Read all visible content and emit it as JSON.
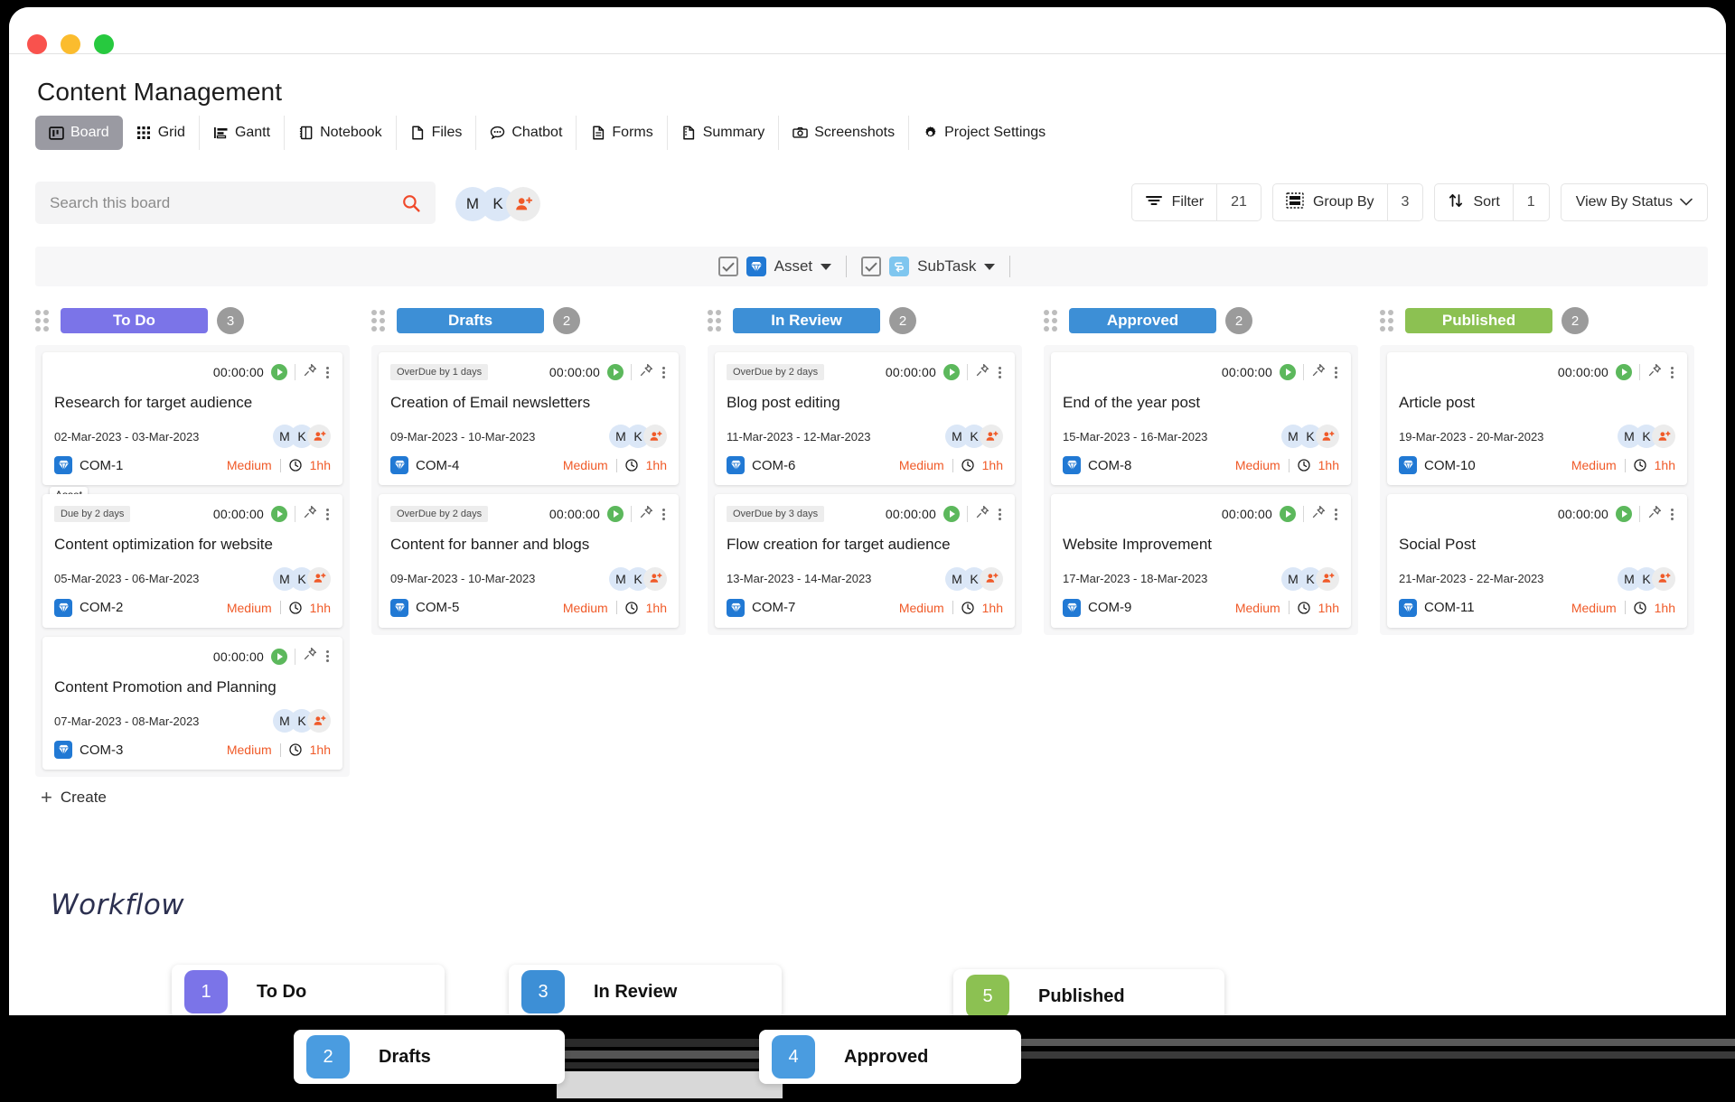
{
  "window": {
    "traffic_lights": [
      "close",
      "minimize",
      "maximize"
    ]
  },
  "header": {
    "title": "Content Management"
  },
  "tabs": [
    {
      "label": "Board",
      "icon": "board-icon",
      "active": true
    },
    {
      "label": "Grid",
      "icon": "grid-icon",
      "active": false
    },
    {
      "label": "Gantt",
      "icon": "gantt-icon",
      "active": false
    },
    {
      "label": "Notebook",
      "icon": "notebook-icon",
      "active": false
    },
    {
      "label": "Files",
      "icon": "file-icon",
      "active": false
    },
    {
      "label": "Chatbot",
      "icon": "chat-icon",
      "active": false
    },
    {
      "label": "Forms",
      "icon": "form-icon",
      "active": false
    },
    {
      "label": "Summary",
      "icon": "summary-icon",
      "active": false
    },
    {
      "label": "Screenshots",
      "icon": "camera-icon",
      "active": false
    },
    {
      "label": "Project Settings",
      "icon": "gear-icon",
      "active": false
    }
  ],
  "toolbar": {
    "search": {
      "placeholder": "Search this board",
      "value": ""
    },
    "avatars": [
      {
        "initial": "M",
        "color": "#dbe7f7"
      },
      {
        "initial": "K",
        "color": "#dbe7f7"
      }
    ],
    "add_user_label": "add-user",
    "filter": {
      "label": "Filter",
      "count": "21"
    },
    "group_by": {
      "label": "Group By",
      "count": "3"
    },
    "sort": {
      "label": "Sort",
      "count": "1"
    },
    "view": {
      "label": "View By Status"
    }
  },
  "subbar": {
    "asset": {
      "label": "Asset",
      "checked": true
    },
    "subtask": {
      "label": "SubTask",
      "checked": true
    }
  },
  "columns": [
    {
      "name": "To Do",
      "color": "#7b74e8",
      "count": "3",
      "create_label": "Create",
      "show_create": true,
      "cards": [
        {
          "due_badge": "",
          "timer": "00:00:00",
          "title": "Research for target audience",
          "dates": "02-Mar-2023 - 03-Mar-2023",
          "ticket": "COM-1",
          "priority": "Medium",
          "estimate": "1hh",
          "avatars": [
            "M",
            "K"
          ],
          "tooltip": "Asset"
        },
        {
          "due_badge": "Due by 2 days",
          "timer": "00:00:00",
          "title": "Content optimization for website",
          "dates": "05-Mar-2023 - 06-Mar-2023",
          "ticket": "COM-2",
          "priority": "Medium",
          "estimate": "1hh",
          "avatars": [
            "M",
            "K"
          ],
          "tooltip": ""
        },
        {
          "due_badge": "",
          "timer": "00:00:00",
          "title": "Content Promotion and Planning",
          "dates": "07-Mar-2023 - 08-Mar-2023",
          "ticket": "COM-3",
          "priority": "Medium",
          "estimate": "1hh",
          "avatars": [
            "M",
            "K"
          ],
          "tooltip": ""
        }
      ]
    },
    {
      "name": "Drafts",
      "color": "#3d8fd6",
      "count": "2",
      "create_label": "Create",
      "show_create": false,
      "cards": [
        {
          "due_badge": "OverDue by 1 days",
          "timer": "00:00:00",
          "title": "Creation of Email newsletters",
          "dates": "09-Mar-2023 - 10-Mar-2023",
          "ticket": "COM-4",
          "priority": "Medium",
          "estimate": "1hh",
          "avatars": [
            "M",
            "K"
          ],
          "tooltip": ""
        },
        {
          "due_badge": "OverDue by 2 days",
          "timer": "00:00:00",
          "title": "Content for banner and blogs",
          "dates": "09-Mar-2023 - 10-Mar-2023",
          "ticket": "COM-5",
          "priority": "Medium",
          "estimate": "1hh",
          "avatars": [
            "M",
            "K"
          ],
          "tooltip": ""
        }
      ]
    },
    {
      "name": "In Review",
      "color": "#3d8fd6",
      "count": "2",
      "create_label": "Create",
      "show_create": false,
      "cards": [
        {
          "due_badge": "OverDue by 2 days",
          "timer": "00:00:00",
          "title": "Blog post editing",
          "dates": "11-Mar-2023 - 12-Mar-2023",
          "ticket": "COM-6",
          "priority": "Medium",
          "estimate": "1hh",
          "avatars": [
            "M",
            "K"
          ],
          "tooltip": ""
        },
        {
          "due_badge": "OverDue by 3 days",
          "timer": "00:00:00",
          "title": "Flow creation for target audience",
          "dates": "13-Mar-2023 - 14-Mar-2023",
          "ticket": "COM-7",
          "priority": "Medium",
          "estimate": "1hh",
          "avatars": [
            "M",
            "K"
          ],
          "tooltip": ""
        }
      ]
    },
    {
      "name": "Approved",
      "color": "#3d8fd6",
      "count": "2",
      "create_label": "Create",
      "show_create": false,
      "cards": [
        {
          "due_badge": "",
          "timer": "00:00:00",
          "title": "End of the year post",
          "dates": "15-Mar-2023 - 16-Mar-2023",
          "ticket": "COM-8",
          "priority": "Medium",
          "estimate": "1hh",
          "avatars": [
            "M",
            "K"
          ],
          "tooltip": ""
        },
        {
          "due_badge": "",
          "timer": "00:00:00",
          "title": "Website Improvement",
          "dates": "17-Mar-2023 - 18-Mar-2023",
          "ticket": "COM-9",
          "priority": "Medium",
          "estimate": "1hh",
          "avatars": [
            "M",
            "K"
          ],
          "tooltip": ""
        }
      ]
    },
    {
      "name": "Published",
      "color": "#8cc152",
      "count": "2",
      "create_label": "Create",
      "show_create": false,
      "cards": [
        {
          "due_badge": "",
          "timer": "00:00:00",
          "title": "Article post",
          "dates": "19-Mar-2023 - 20-Mar-2023",
          "ticket": "COM-10",
          "priority": "Medium",
          "estimate": "1hh",
          "avatars": [
            "M",
            "K"
          ],
          "tooltip": ""
        },
        {
          "due_badge": "",
          "timer": "00:00:00",
          "title": "Social Post",
          "dates": "21-Mar-2023 - 22-Mar-2023",
          "ticket": "COM-11",
          "priority": "Medium",
          "estimate": "1hh",
          "avatars": [
            "M",
            "K"
          ],
          "tooltip": ""
        }
      ]
    }
  ],
  "workflow": {
    "title": "Workflow",
    "steps": [
      {
        "number": "1",
        "label": "To Do",
        "color": "#7b74e8"
      },
      {
        "number": "2",
        "label": "Drafts",
        "color": "#4a9ce0"
      },
      {
        "number": "3",
        "label": "In Review",
        "color": "#3d8fd6"
      },
      {
        "number": "4",
        "label": "Approved",
        "color": "#4a9ce0"
      },
      {
        "number": "5",
        "label": "Published",
        "color": "#8cc152"
      }
    ],
    "connector_color": "#3d8fd6"
  },
  "colors": {
    "accent_orange": "#f05a28",
    "todo": "#7b74e8",
    "blue": "#3d8fd6",
    "green": "#8cc152",
    "count_grey": "#9b9b9b"
  }
}
